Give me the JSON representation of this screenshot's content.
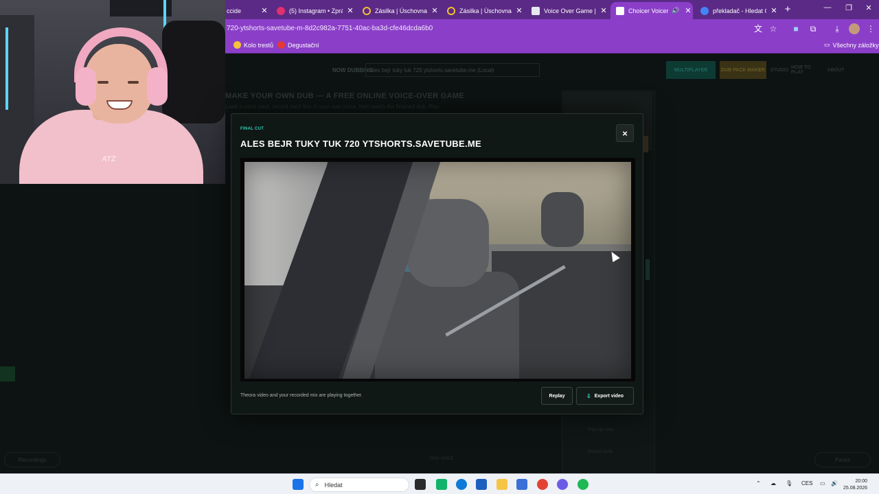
{
  "browser": {
    "tabs": [
      {
        "label": "ccide",
        "color": "#5b2a86",
        "active": false
      },
      {
        "label": "(5) Instagram • Zpráv",
        "color": "#e1306c",
        "active": false
      },
      {
        "label": "Zásilka | Úschovna.cz",
        "color": "#f2c230",
        "active": false
      },
      {
        "label": "Zásilka | Úschovna.cz",
        "color": "#f2c230",
        "active": false
      },
      {
        "label": "Voice Over Game | Pl",
        "color": "#e7e7ef",
        "active": false
      },
      {
        "label": "Choicer Voicer St",
        "color": "#ffffff",
        "active": true
      },
      {
        "label": "překladač - Hledat G",
        "color": "#4285f4",
        "active": false
      }
    ],
    "url": "720-ytshorts-savetube-m-8d2c982a-7751-40ac-ba3d-cfe46dcda6b0",
    "bookmarks": [
      {
        "label": "Kolo trestů",
        "color": "#f6c33c"
      },
      {
        "label": "Degustační",
        "color": "#e53935"
      }
    ],
    "bookmarks_all": "Všechny záložky"
  },
  "page_bg": {
    "now_dubbing_label": "NOW DUBBING",
    "source_select": "ales bejr tuky tuk 720 ytshorts.savetube.me (Local)",
    "nav_buttons": [
      "MULTIPLAYER",
      "DUB PACK MAKER"
    ],
    "nav_links": [
      "STUDIO",
      "HOW TO PLAY",
      "ABOUT"
    ],
    "heading": "MAKE YOUR OWN DUB — A FREE ONLINE VOICE-OVER GAME",
    "subheading": "Load a voice pack, record each line in your own voice, then watch the finished dub. Play",
    "panel_labels": [
      "Play clip video",
      "Record mode"
    ],
    "recordings_pill": "Recordings",
    "packs_pill": "Packs",
    "center_hint": "PICK VOICE"
  },
  "modal": {
    "kicker": "FINAL CUT",
    "title": "ALES BEJR TUKY TUK 720 YTSHORTS.SAVETUBE.ME",
    "close_label": "×",
    "footer_text": "Theora video and your recorded mix are playing together.",
    "replay_label": "Replay",
    "export_label": "Export video",
    "export_icon": "⇩"
  },
  "taskbar": {
    "search_placeholder": "Hledat",
    "language": "CES",
    "time": "20:00",
    "date": "25.08.2026"
  }
}
